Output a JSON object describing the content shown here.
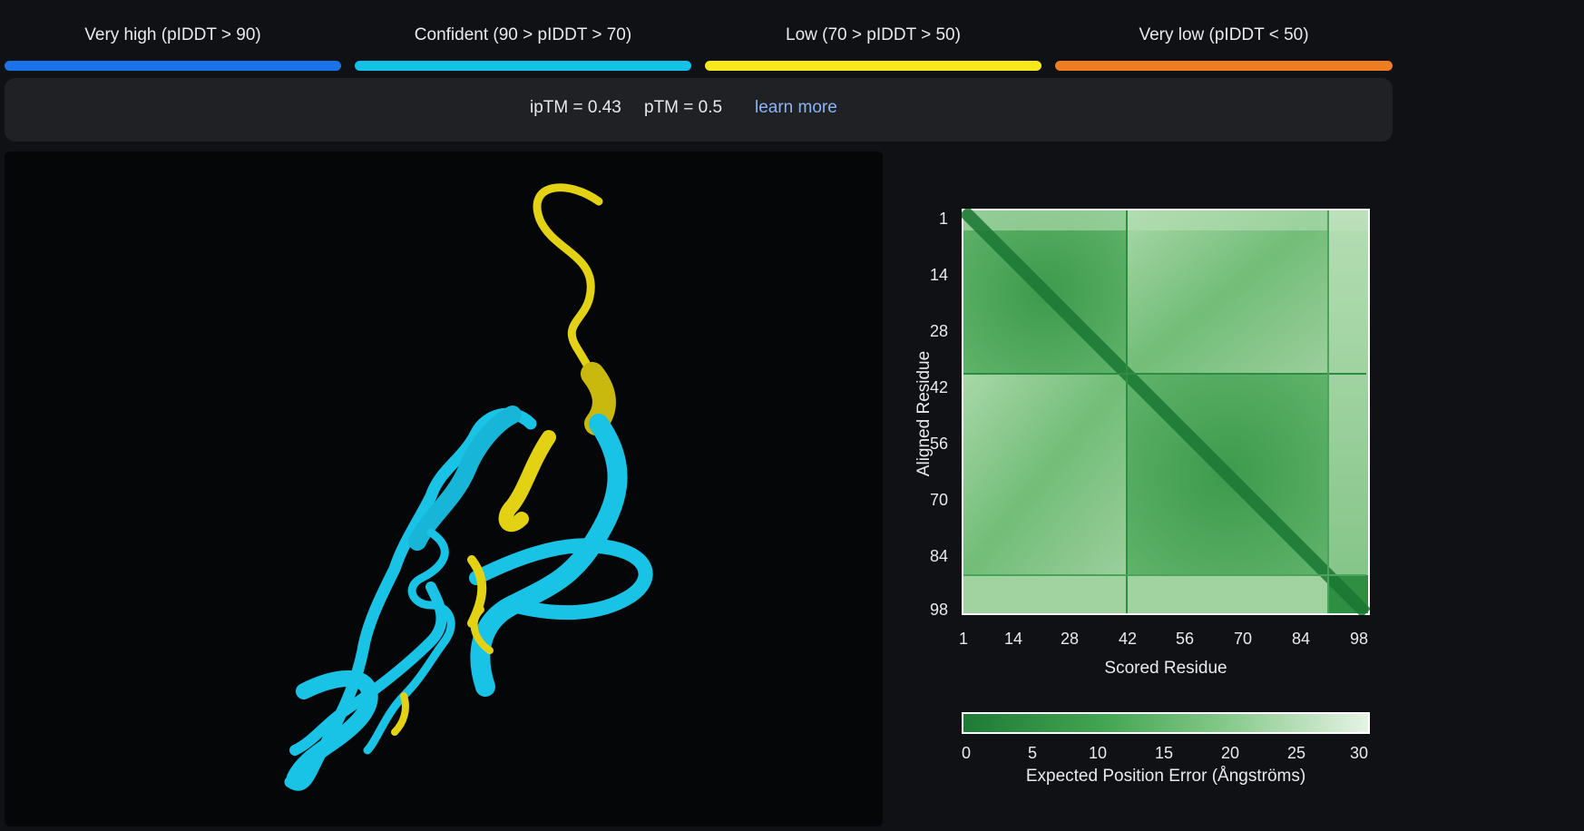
{
  "plddt_legend": [
    {
      "label": "Very high (pIDDT > 90)",
      "color": "#1a73e8"
    },
    {
      "label": "Confident (90 > pIDDT > 70)",
      "color": "#12c2e9"
    },
    {
      "label": "Low (70 > pIDDT > 50)",
      "color": "#f6e81b"
    },
    {
      "label": "Very low (pIDDT < 50)",
      "color": "#ef7e22"
    }
  ],
  "stats": {
    "iptm": "ipTM = 0.43",
    "ptm": "pTM = 0.5",
    "learn_more": "learn more"
  },
  "structure_viewer": {
    "colors": {
      "confident": "#19c3e6",
      "low": "#e3d113"
    }
  },
  "pae": {
    "y_label": "Aligned Residue",
    "x_label": "Scored Residue",
    "y_ticks": [
      "1",
      "14",
      "28",
      "42",
      "56",
      "70",
      "84",
      "98"
    ],
    "x_ticks": [
      "1",
      "14",
      "28",
      "42",
      "56",
      "70",
      "84",
      "98"
    ],
    "colorbar_ticks": [
      "0",
      "5",
      "10",
      "15",
      "20",
      "25",
      "30"
    ],
    "colorbar_label": "Expected Position Error (Ångströms)",
    "colors": {
      "low_error": "#1e7a35",
      "high_error": "#e6f3e4"
    }
  }
}
